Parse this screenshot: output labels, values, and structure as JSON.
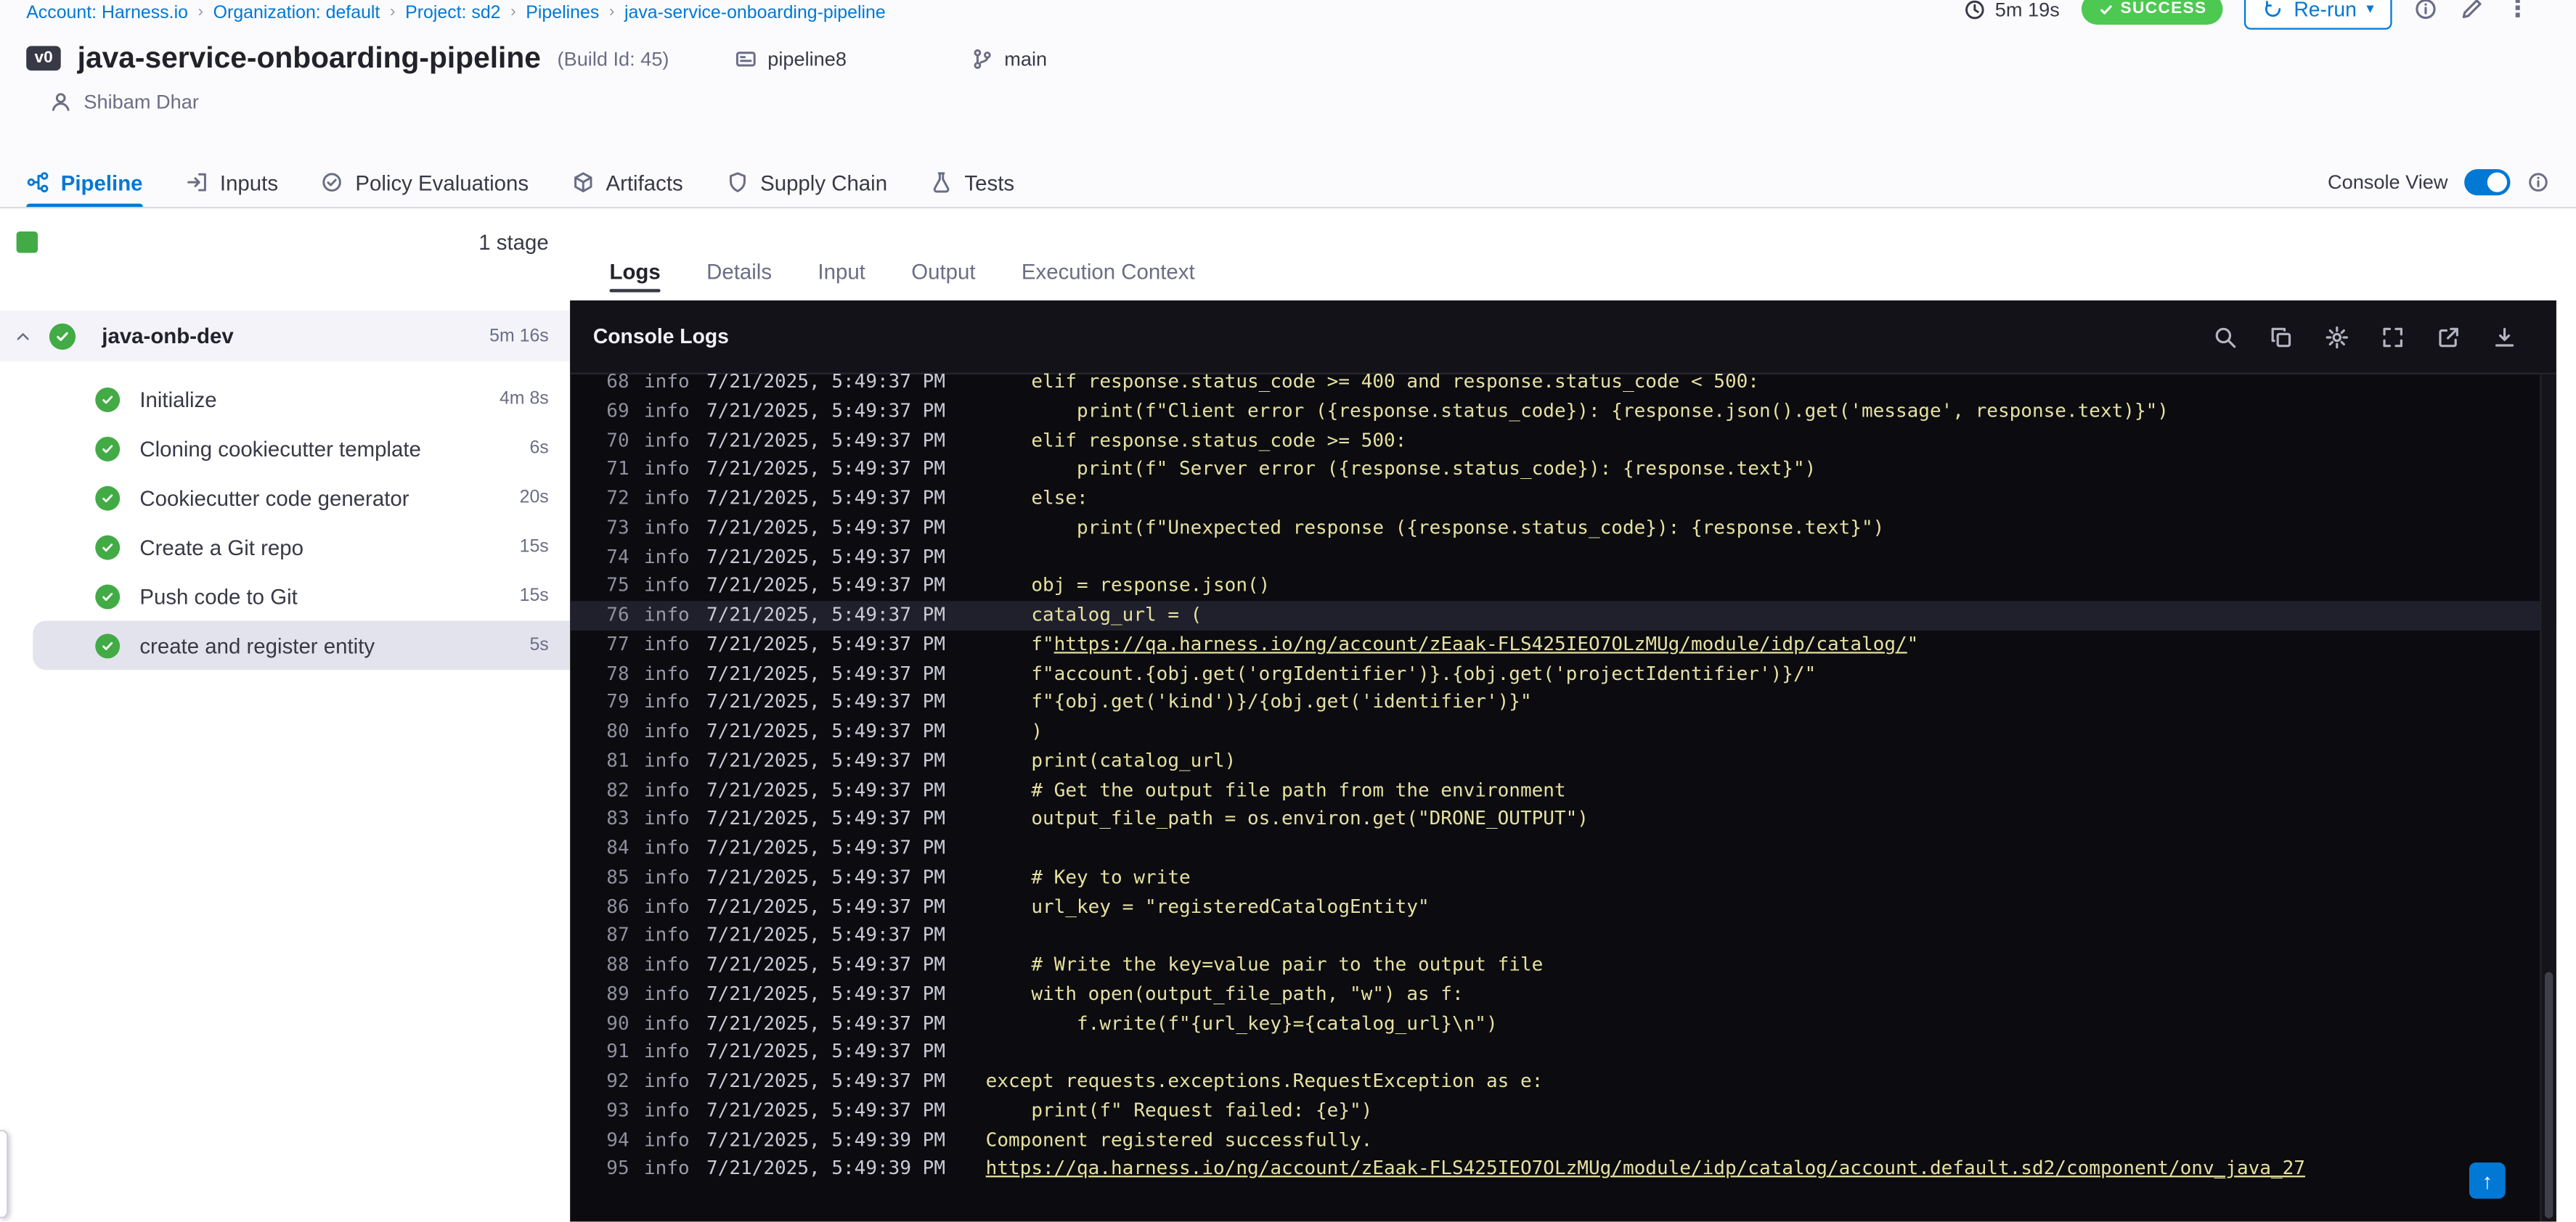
{
  "colors": {
    "accent": "#0278d5",
    "success": "#42ab45",
    "success-badge": "#4dc952",
    "text-dark": "#22222a",
    "text-gray": "#6b6d85",
    "console-bg": "#0b0b10",
    "console-header-bg": "#121218",
    "log-yellow": "#e6e1a0",
    "highlight-row": "#20202c"
  },
  "breadcrumb": {
    "separator": "›",
    "items": [
      "Account: Harness.io",
      "Organization: default",
      "Project: sd2",
      "Pipelines",
      "java-service-onboarding-pipeline"
    ]
  },
  "topbar": {
    "duration": "5m 19s",
    "status": "SUCCESS",
    "rerun": "Re-run"
  },
  "header": {
    "version_badge": "v0",
    "title": "java-service-onboarding-pipeline",
    "build_id": "(Build Id: 45)",
    "pipeline_tag": "pipeline8",
    "branch": "main",
    "user": "Shibam Dhar"
  },
  "tabs": {
    "console_view": "Console View",
    "toggle_on": true,
    "items": [
      {
        "label": "Pipeline",
        "icon": "pipeline-icon",
        "active": true
      },
      {
        "label": "Inputs",
        "icon": "inputs-icon"
      },
      {
        "label": "Policy Evaluations",
        "icon": "policy-evaluations-icon"
      },
      {
        "label": "Artifacts",
        "icon": "artifacts-icon"
      },
      {
        "label": "Supply Chain",
        "icon": "supply-chain-icon"
      },
      {
        "label": "Tests",
        "icon": "tests-icon"
      }
    ]
  },
  "sidebar": {
    "stage_count": "1 stage",
    "stage": {
      "name": "java-onb-dev",
      "duration": "5m 16s"
    },
    "steps": [
      {
        "name": "Initialize",
        "duration": "4m 8s"
      },
      {
        "name": "Cloning cookiecutter template",
        "duration": "6s"
      },
      {
        "name": "Cookiecutter code generator",
        "duration": "20s"
      },
      {
        "name": "Create a Git repo",
        "duration": "15s"
      },
      {
        "name": "Push code to Git",
        "duration": "15s"
      },
      {
        "name": "create and register entity",
        "duration": "5s",
        "selected": true
      }
    ]
  },
  "main": {
    "tabs": [
      {
        "label": "Logs",
        "active": true
      },
      {
        "label": "Details"
      },
      {
        "label": "Input"
      },
      {
        "label": "Output"
      },
      {
        "label": "Execution Context"
      }
    ],
    "console": {
      "title": "Console Logs",
      "icons": [
        "search-icon",
        "copy-icon",
        "settings-icon",
        "fullscreen-icon",
        "open-in-new-icon",
        "download-icon"
      ],
      "lines": [
        {
          "num": 68,
          "level": "info",
          "time": "7/21/2025, 5:49:37 PM",
          "indent": 4,
          "text": "elif response.status_code >= 400 and response.status_code < 500:"
        },
        {
          "num": 69,
          "level": "info",
          "time": "7/21/2025, 5:49:37 PM",
          "indent": 8,
          "text": "print(f\"Client error ({response.status_code}): {response.json().get('message', response.text)}\")"
        },
        {
          "num": 70,
          "level": "info",
          "time": "7/21/2025, 5:49:37 PM",
          "indent": 4,
          "text": "elif response.status_code >= 500:"
        },
        {
          "num": 71,
          "level": "info",
          "time": "7/21/2025, 5:49:37 PM",
          "indent": 8,
          "text": "print(f\" Server error ({response.status_code}): {response.text}\")"
        },
        {
          "num": 72,
          "level": "info",
          "time": "7/21/2025, 5:49:37 PM",
          "indent": 4,
          "text": "else:"
        },
        {
          "num": 73,
          "level": "info",
          "time": "7/21/2025, 5:49:37 PM",
          "indent": 8,
          "text": "print(f\"Unexpected response ({response.status_code}): {response.text}\")"
        },
        {
          "num": 74,
          "level": "info",
          "time": "7/21/2025, 5:49:37 PM",
          "indent": 0,
          "text": ""
        },
        {
          "num": 75,
          "level": "info",
          "time": "7/21/2025, 5:49:37 PM",
          "indent": 4,
          "text": "obj = response.json()"
        },
        {
          "num": 76,
          "level": "info",
          "time": "7/21/2025, 5:49:37 PM",
          "indent": 4,
          "text": "catalog_url = (",
          "highlight": true
        },
        {
          "num": 77,
          "level": "info",
          "time": "7/21/2025, 5:49:37 PM",
          "indent": 4,
          "pre": "f\"",
          "link": "https://qa.harness.io/ng/account/zEaak-FLS425IEO7OLzMUg/module/idp/catalog/",
          "post": "\""
        },
        {
          "num": 78,
          "level": "info",
          "time": "7/21/2025, 5:49:37 PM",
          "indent": 4,
          "text": "f\"account.{obj.get('orgIdentifier')}.{obj.get('projectIdentifier')}/\""
        },
        {
          "num": 79,
          "level": "info",
          "time": "7/21/2025, 5:49:37 PM",
          "indent": 4,
          "text": "f\"{obj.get('kind')}/{obj.get('identifier')}\""
        },
        {
          "num": 80,
          "level": "info",
          "time": "7/21/2025, 5:49:37 PM",
          "indent": 4,
          "text": ")"
        },
        {
          "num": 81,
          "level": "info",
          "time": "7/21/2025, 5:49:37 PM",
          "indent": 4,
          "text": "print(catalog_url)"
        },
        {
          "num": 82,
          "level": "info",
          "time": "7/21/2025, 5:49:37 PM",
          "indent": 4,
          "text": "# Get the output file path from the environment"
        },
        {
          "num": 83,
          "level": "info",
          "time": "7/21/2025, 5:49:37 PM",
          "indent": 4,
          "text": "output_file_path = os.environ.get(\"DRONE_OUTPUT\")"
        },
        {
          "num": 84,
          "level": "info",
          "time": "7/21/2025, 5:49:37 PM",
          "indent": 0,
          "text": ""
        },
        {
          "num": 85,
          "level": "info",
          "time": "7/21/2025, 5:49:37 PM",
          "indent": 4,
          "text": "# Key to write"
        },
        {
          "num": 86,
          "level": "info",
          "time": "7/21/2025, 5:49:37 PM",
          "indent": 4,
          "text": "url_key = \"registeredCatalogEntity\""
        },
        {
          "num": 87,
          "level": "info",
          "time": "7/21/2025, 5:49:37 PM",
          "indent": 0,
          "text": ""
        },
        {
          "num": 88,
          "level": "info",
          "time": "7/21/2025, 5:49:37 PM",
          "indent": 4,
          "text": "# Write the key=value pair to the output file"
        },
        {
          "num": 89,
          "level": "info",
          "time": "7/21/2025, 5:49:37 PM",
          "indent": 4,
          "text": "with open(output_file_path, \"w\") as f:"
        },
        {
          "num": 90,
          "level": "info",
          "time": "7/21/2025, 5:49:37 PM",
          "indent": 8,
          "text": "f.write(f\"{url_key}={catalog_url}\\n\")"
        },
        {
          "num": 91,
          "level": "info",
          "time": "7/21/2025, 5:49:37 PM",
          "indent": 0,
          "text": ""
        },
        {
          "num": 92,
          "level": "info",
          "time": "7/21/2025, 5:49:37 PM",
          "indent": 0,
          "text": "except requests.exceptions.RequestException as e:"
        },
        {
          "num": 93,
          "level": "info",
          "time": "7/21/2025, 5:49:37 PM",
          "indent": 4,
          "text": "print(f\" Request failed: {e}\")"
        },
        {
          "num": 94,
          "level": "info",
          "time": "7/21/2025, 5:49:39 PM",
          "indent": 0,
          "text": "Component registered successfully."
        },
        {
          "num": 95,
          "level": "info",
          "time": "7/21/2025, 5:49:39 PM",
          "indent": 0,
          "link": "https://qa.harness.io/ng/account/zEaak-FLS425IEO7OLzMUg/module/idp/catalog/account.default.sd2/component/onv_java_27"
        }
      ]
    }
  }
}
